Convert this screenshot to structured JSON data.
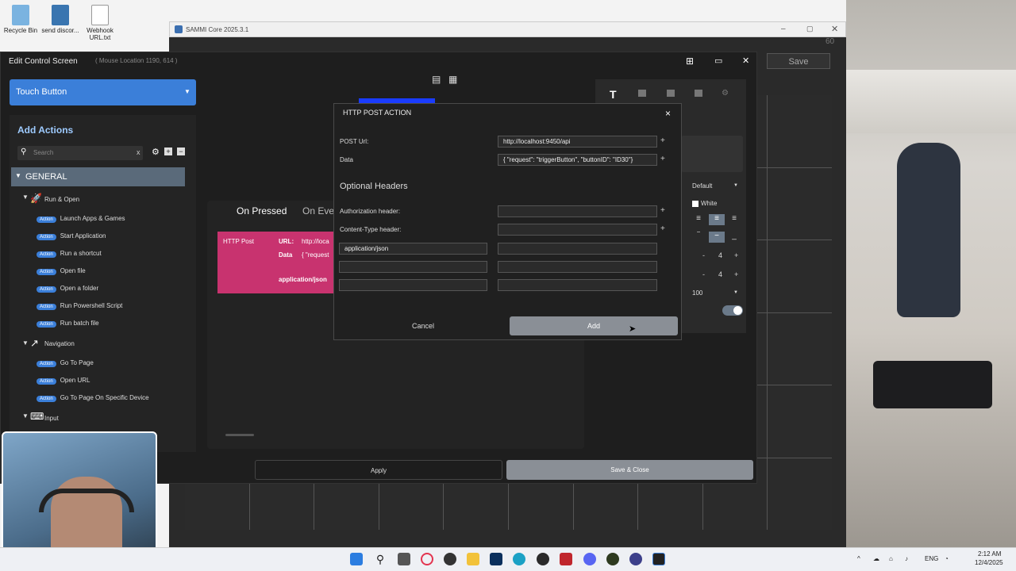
{
  "desktop": {
    "icons": [
      "Recycle Bin",
      "send discor...",
      "Webhook URL.txt"
    ]
  },
  "window": {
    "title": "SAMMI Core 2025.3.1",
    "fps": "60",
    "save_label": "Save"
  },
  "editor": {
    "title": "Edit Control Screen",
    "mouse_location": "( Mouse Location 1190, 614 )",
    "dropdown": "Touch Button",
    "add_actions": "Add Actions",
    "search_placeholder": "Search",
    "clear": "x",
    "general": "GENERAL",
    "categories": [
      {
        "label": "Run & Open",
        "actions": [
          "Launch Apps & Games",
          "Start Application",
          "Run a shortcut",
          "Open file",
          "Open a folder",
          "Run Powershell Script",
          "Run batch file"
        ]
      },
      {
        "label": "Navigation",
        "actions": [
          "Go To Page",
          "Open URL",
          "Go To Page On Specific Device"
        ]
      },
      {
        "label": "Input",
        "actions": []
      }
    ],
    "action_tag": "Action",
    "tabs": [
      "On Pressed",
      "On Event"
    ],
    "card": {
      "name": "HTTP Post",
      "url_label": "URL:",
      "url_value": "http://loca",
      "data_label": "Data",
      "data_value": "{   \"request",
      "content_type": "application/json"
    },
    "apply_label": "Apply",
    "save_close_label": "Save & Close"
  },
  "right_panel": {
    "font": "Default",
    "color": "White",
    "num1": "4",
    "num2": "4",
    "percent": "100",
    "minus": "-",
    "plus": "+"
  },
  "dialog": {
    "title": "HTTP POST ACTION",
    "close": "×",
    "post_url_label": "POST Url:",
    "post_url_value": "http://localhost:9450/api",
    "data_label": "Data",
    "data_value": "{   \"request\": \"triggerButton\",   \"buttonID\": \"ID30\"}",
    "optional_headers": "Optional Headers",
    "auth_label": "Authorization header:",
    "content_type_label": "Content-Type header:",
    "header_key_1": "application/json",
    "plus": "+",
    "cancel_label": "Cancel",
    "add_label": "Add"
  },
  "taskbar": {
    "lang": "ENG",
    "time": "2:12 AM",
    "date": "12/4/2025"
  }
}
